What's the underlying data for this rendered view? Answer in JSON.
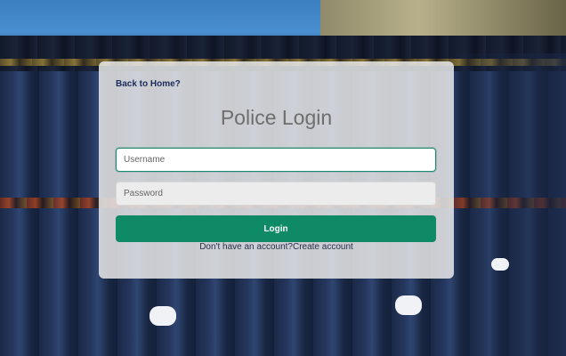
{
  "page": {
    "accent_color": "#0f8a66",
    "card_background": "rgba(232,232,232,0.86)"
  },
  "login": {
    "back_link": "Back to Home?",
    "title": "Police Login",
    "username_placeholder": "Username",
    "password_placeholder": "Password",
    "submit_label": "Login",
    "signup_prompt": "Don't have an account?",
    "signup_link": "Create account"
  },
  "background": {
    "description_icon": "parade-photo"
  }
}
